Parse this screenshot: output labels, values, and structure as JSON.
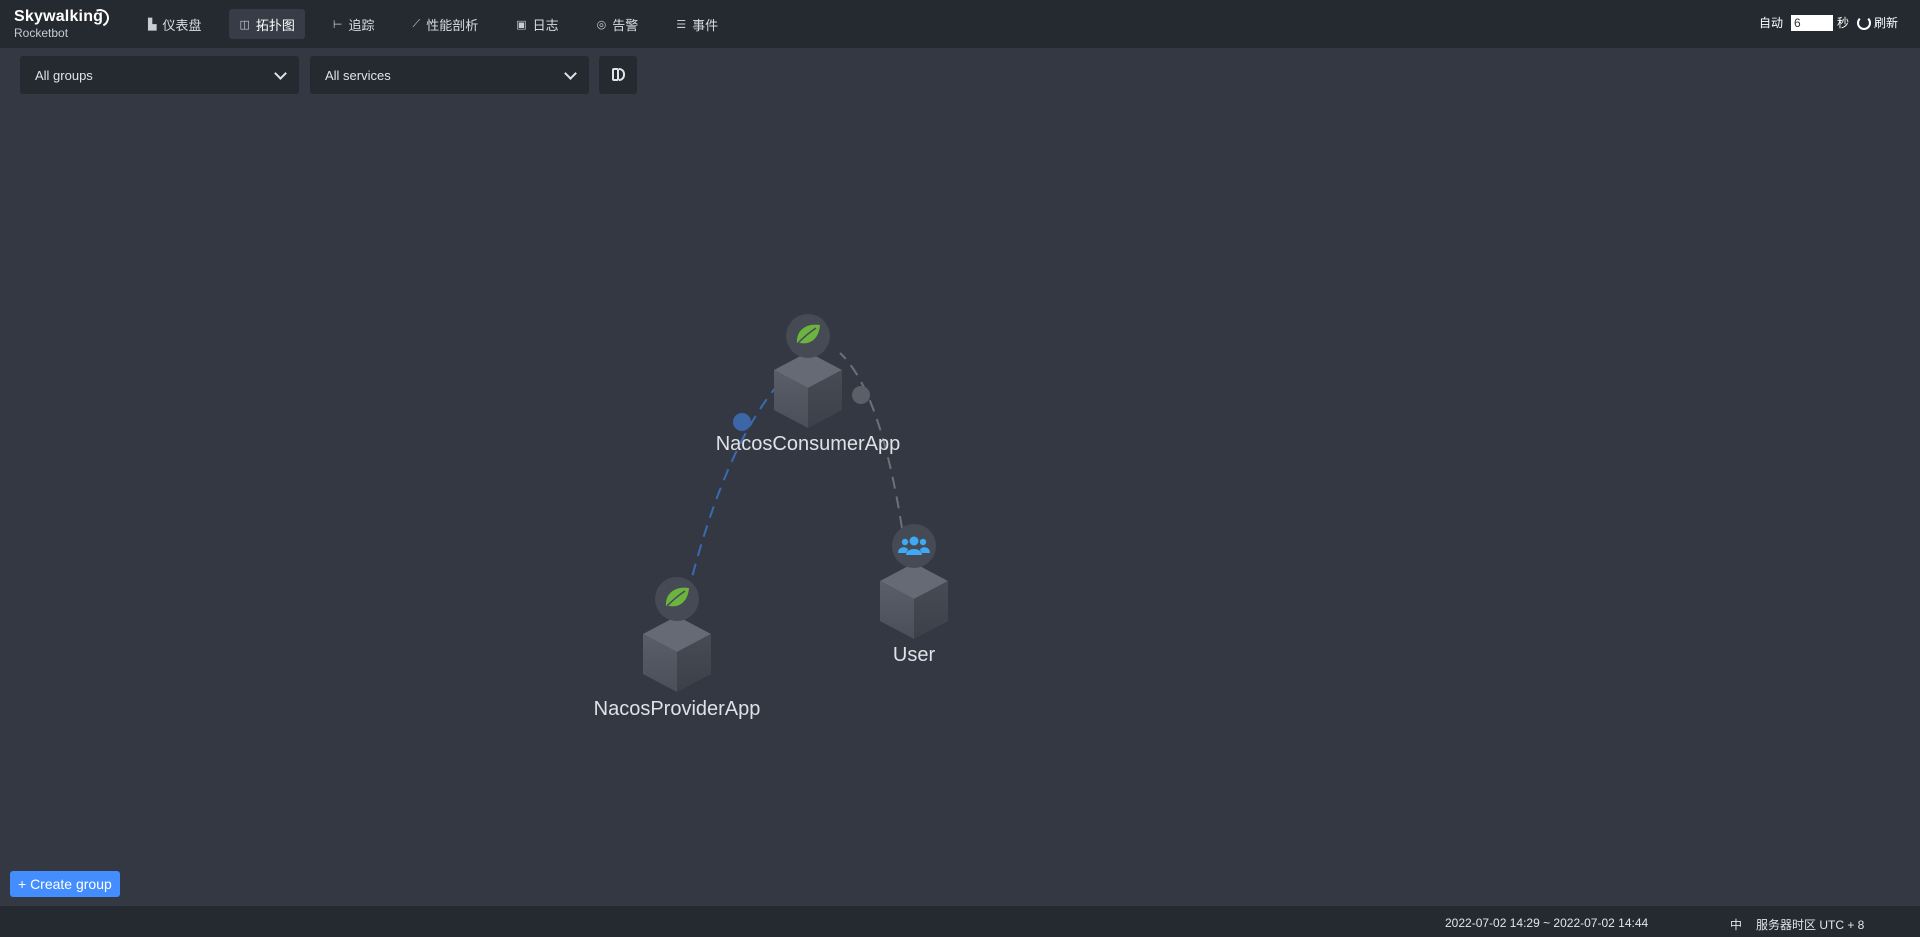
{
  "app": {
    "title": "Skywalking",
    "subtitle": "Rocketbot"
  },
  "nav": [
    {
      "icon": "bar-chart-icon",
      "glyph": "▙",
      "label": "仪表盘",
      "active": false
    },
    {
      "icon": "topology-icon",
      "glyph": "◫",
      "label": "拓扑图",
      "active": true
    },
    {
      "icon": "trace-icon",
      "glyph": "⊢",
      "label": "追踪",
      "active": false
    },
    {
      "icon": "profile-icon",
      "glyph": "⟋",
      "label": "性能剖析",
      "active": false
    },
    {
      "icon": "log-icon",
      "glyph": "▣",
      "label": "日志",
      "active": false
    },
    {
      "icon": "alarm-icon",
      "glyph": "◎",
      "label": "告警",
      "active": false
    },
    {
      "icon": "event-icon",
      "glyph": "☰",
      "label": "事件",
      "active": false
    }
  ],
  "toolbar": {
    "auto_label": "自动",
    "interval_value": "6",
    "unit_label": "秒",
    "refresh_label": "刷新"
  },
  "filters": {
    "group_select": "All groups",
    "service_select": "All services"
  },
  "topology": {
    "nodes": [
      {
        "name": "NacosConsumerApp",
        "icon": "spring-leaf-icon"
      },
      {
        "name": "NacosProviderApp",
        "icon": "spring-leaf-icon"
      },
      {
        "name": "User",
        "icon": "users-icon"
      }
    ],
    "edges": [
      {
        "from": "NacosConsumerApp",
        "to": "NacosProviderApp",
        "color": "#3a6bb0"
      },
      {
        "from": "User",
        "to": "NacosConsumerApp",
        "color": "#6c707a"
      }
    ]
  },
  "create_group_label": "+ Create group",
  "footer": {
    "time_range": "2022-07-02 14:29 ~ 2022-07-02 14:44",
    "lang": "中",
    "timezone": "服务器时区 UTC + 8"
  },
  "colors": {
    "background": "#333843",
    "bar": "#252a30",
    "accent": "#448dfe",
    "spring": "#6db33f",
    "users": "#3fa9f5"
  }
}
